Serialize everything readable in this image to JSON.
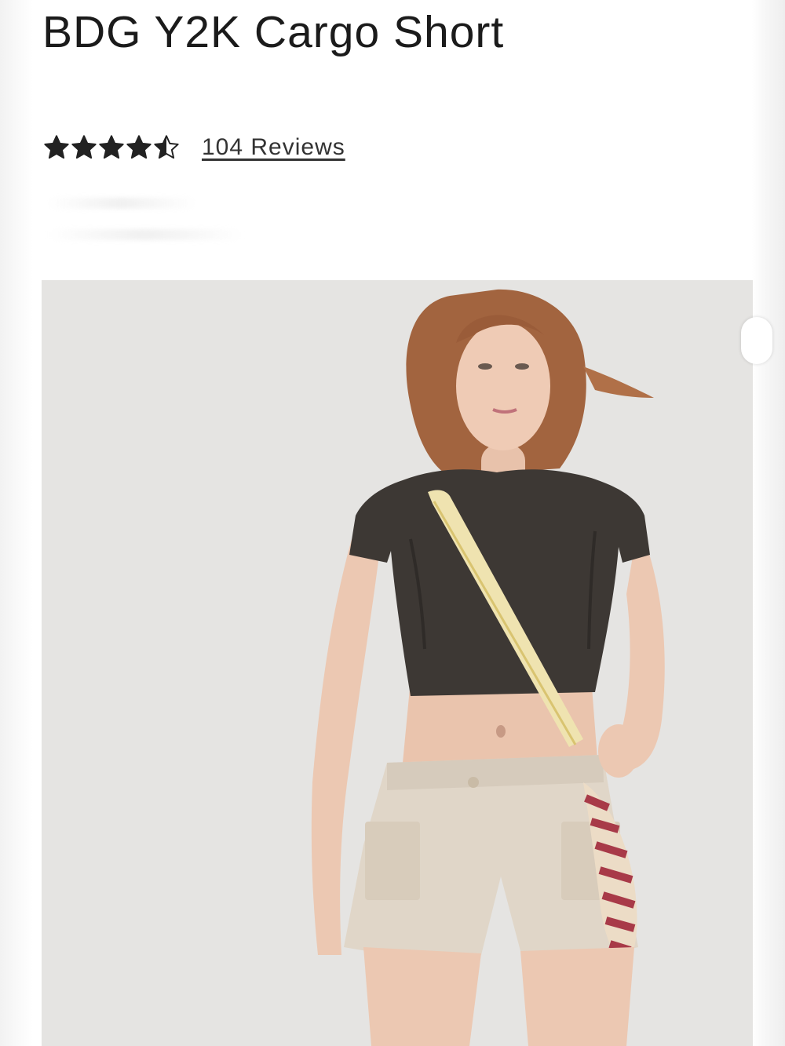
{
  "product": {
    "title": "BDG Y2K Cargo Short",
    "rating": {
      "value": 4.5,
      "max": 5,
      "reviews_label": "104 Reviews"
    },
    "image": {
      "icon": "product-photo"
    }
  },
  "colors": {
    "star": "#222222",
    "image_bg": "#e4e3e1",
    "top": "#3d3834",
    "shorts": "#e0d6c8",
    "strap": "#efe3b0",
    "bag_stripe_red": "#a83a48",
    "bag_stripe_cream": "#ecdcc6"
  }
}
